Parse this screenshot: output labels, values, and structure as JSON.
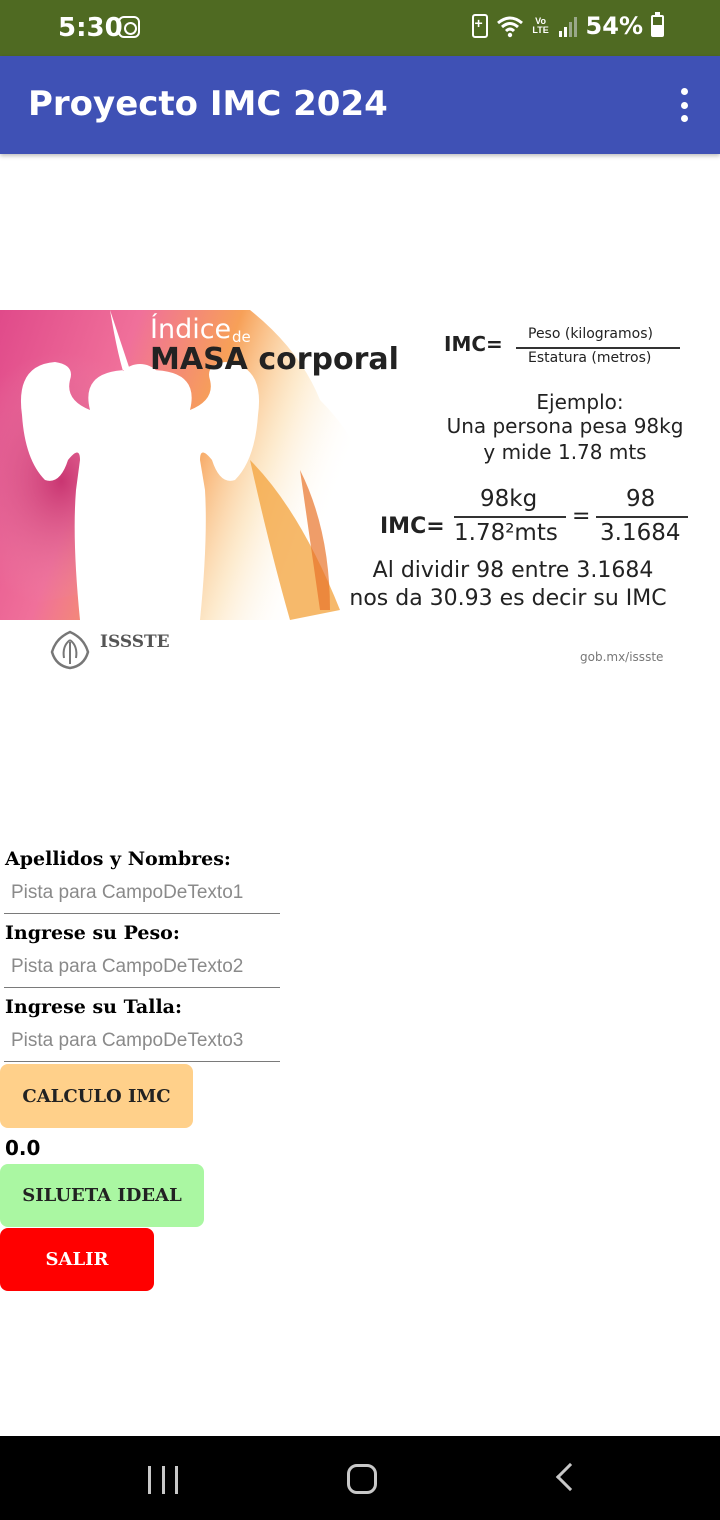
{
  "status_bar": {
    "time": "5:30",
    "battery_pct": "54%",
    "volte": "Vo LTE",
    "icons": [
      "instagram-icon",
      "battery-saver-icon",
      "wifi-icon",
      "volte-icon",
      "signal-icon",
      "battery-icon"
    ]
  },
  "app_bar": {
    "title": "Proyecto IMC 2024",
    "menu_icon": "more-vert-icon",
    "color": "#3f51b5"
  },
  "banner": {
    "heading_light": "Índice",
    "heading_de": "de",
    "heading_bold": "MASA corporal",
    "formula_label": "IMC=",
    "formula_numerator": "Peso (kilogramos)",
    "formula_denominator": "Estatura  (metros)",
    "example_title": "Ejemplo:",
    "example_line1": "Una persona pesa 98kg",
    "example_line2": "y mide 1.78 mts",
    "calc_label": "IMC=",
    "calc_num1": "98kg",
    "calc_den1": "1.78²mts",
    "calc_eq": "=",
    "calc_num2": "98",
    "calc_den2": "3.1684",
    "result_line1": "Al dividir 98 entre 3.1684",
    "result_line2": "nos da 30.93 es decir su IMC",
    "logo_text": "ISSSTE",
    "source": "gob.mx/issste"
  },
  "form": {
    "name_label": "Apellidos y Nombres:",
    "name_placeholder": "Pista para CampoDeTexto1",
    "weight_label": "Ingrese su Peso:",
    "weight_placeholder": "Pista para CampoDeTexto2",
    "height_label": "Ingrese su Talla:",
    "height_placeholder": "Pista para CampoDeTexto3",
    "calc_button": "CALCULO IMC",
    "result_value": "0.0",
    "silhouette_button": "SILUETA IDEAL",
    "exit_button": "SALIR",
    "colors": {
      "calc": "#ffd08a",
      "silhouette": "#aaf7a2",
      "exit": "#ff0000"
    }
  },
  "nav_bar": {
    "icons": [
      "recent-apps-icon",
      "home-icon",
      "back-icon"
    ]
  }
}
